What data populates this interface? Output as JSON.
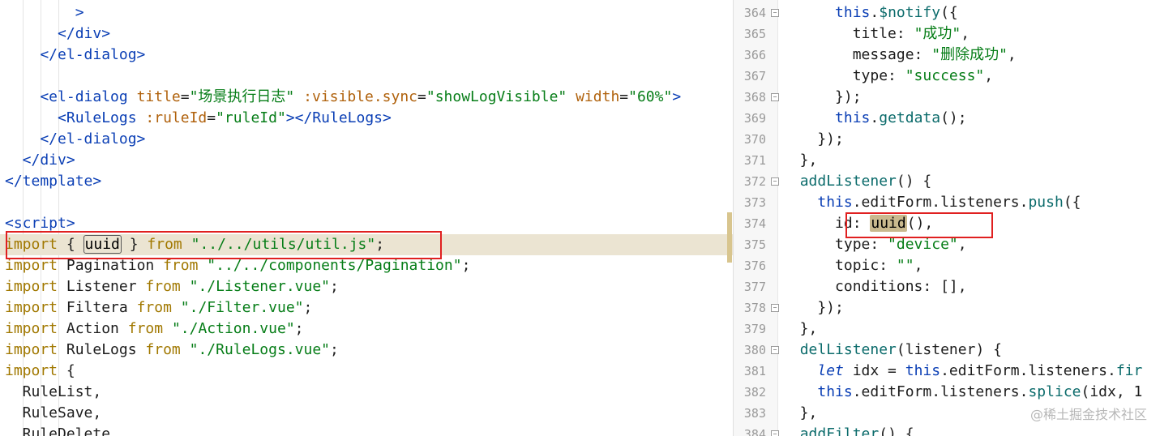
{
  "left_editor": {
    "lines": [
      [
        {
          "t": "        >",
          "c": "tag"
        }
      ],
      [
        {
          "t": "      </div>",
          "c": "tag"
        }
      ],
      [
        {
          "t": "    </el-dialog>",
          "c": "tag"
        }
      ],
      [
        {
          "t": "",
          "c": "plain"
        }
      ],
      [
        {
          "t": "    <el-dialog ",
          "c": "tag"
        },
        {
          "t": "title",
          "c": "attr"
        },
        {
          "t": "=",
          "c": "sym"
        },
        {
          "t": "\"场景执行日志\"",
          "c": "str"
        },
        {
          "t": " :",
          "c": "attr"
        },
        {
          "t": "visible.sync",
          "c": "attr"
        },
        {
          "t": "=",
          "c": "sym"
        },
        {
          "t": "\"showLogVisible\"",
          "c": "str"
        },
        {
          "t": " ",
          "c": "plain"
        },
        {
          "t": "width",
          "c": "attr"
        },
        {
          "t": "=",
          "c": "sym"
        },
        {
          "t": "\"60%\"",
          "c": "str"
        },
        {
          "t": ">",
          "c": "tag"
        }
      ],
      [
        {
          "t": "      <RuleLogs ",
          "c": "tag"
        },
        {
          "t": ":ruleId",
          "c": "attr"
        },
        {
          "t": "=",
          "c": "sym"
        },
        {
          "t": "\"ruleId\"",
          "c": "str"
        },
        {
          "t": "></RuleLogs>",
          "c": "tag"
        }
      ],
      [
        {
          "t": "    </el-dialog>",
          "c": "tag"
        }
      ],
      [
        {
          "t": "  </div>",
          "c": "tag"
        }
      ],
      [
        {
          "t": "</template>",
          "c": "tag"
        }
      ],
      [
        {
          "t": "",
          "c": "plain"
        }
      ],
      [
        {
          "t": "<script>",
          "c": "tag"
        }
      ],
      [
        {
          "t": "import",
          "c": "kw2"
        },
        {
          "t": " { ",
          "c": "plain"
        },
        {
          "t": "uuid",
          "c": "boxed"
        },
        {
          "t": " } ",
          "c": "plain"
        },
        {
          "t": "from",
          "c": "kw2"
        },
        {
          "t": " ",
          "c": "plain"
        },
        {
          "t": "\"../../utils/util.js\"",
          "c": "str"
        },
        {
          "t": ";",
          "c": "plain"
        }
      ],
      [
        {
          "t": "import",
          "c": "kw2"
        },
        {
          "t": " Pagination ",
          "c": "plain"
        },
        {
          "t": "from",
          "c": "kw2"
        },
        {
          "t": " ",
          "c": "plain"
        },
        {
          "t": "\"../../components/Pagination\"",
          "c": "str"
        },
        {
          "t": ";",
          "c": "plain"
        }
      ],
      [
        {
          "t": "import",
          "c": "kw2"
        },
        {
          "t": " Listener ",
          "c": "plain"
        },
        {
          "t": "from",
          "c": "kw2"
        },
        {
          "t": " ",
          "c": "plain"
        },
        {
          "t": "\"./Listener.vue\"",
          "c": "str"
        },
        {
          "t": ";",
          "c": "plain"
        }
      ],
      [
        {
          "t": "import",
          "c": "kw2"
        },
        {
          "t": " Filtera ",
          "c": "plain"
        },
        {
          "t": "from",
          "c": "kw2"
        },
        {
          "t": " ",
          "c": "plain"
        },
        {
          "t": "\"./Filter.vue\"",
          "c": "str"
        },
        {
          "t": ";",
          "c": "plain"
        }
      ],
      [
        {
          "t": "import",
          "c": "kw2"
        },
        {
          "t": " Action ",
          "c": "plain"
        },
        {
          "t": "from",
          "c": "kw2"
        },
        {
          "t": " ",
          "c": "plain"
        },
        {
          "t": "\"./Action.vue\"",
          "c": "str"
        },
        {
          "t": ";",
          "c": "plain"
        }
      ],
      [
        {
          "t": "import",
          "c": "kw2"
        },
        {
          "t": " RuleLogs ",
          "c": "plain"
        },
        {
          "t": "from",
          "c": "kw2"
        },
        {
          "t": " ",
          "c": "plain"
        },
        {
          "t": "\"./RuleLogs.vue\"",
          "c": "str"
        },
        {
          "t": ";",
          "c": "plain"
        }
      ],
      [
        {
          "t": "import",
          "c": "kw2"
        },
        {
          "t": " {",
          "c": "plain"
        }
      ],
      [
        {
          "t": "  RuleList,",
          "c": "plain"
        }
      ],
      [
        {
          "t": "  RuleSave,",
          "c": "plain"
        }
      ],
      [
        {
          "t": "  RuleDelete,",
          "c": "plain"
        }
      ]
    ]
  },
  "right_editor": {
    "lines": [
      {
        "n": "364",
        "fold": true,
        "seg": [
          {
            "t": "      ",
            "c": "plain"
          },
          {
            "t": "this",
            "c": "kw"
          },
          {
            "t": ".",
            "c": "plain"
          },
          {
            "t": "$notify",
            "c": "fn"
          },
          {
            "t": "({",
            "c": "plain"
          }
        ]
      },
      {
        "n": "365",
        "seg": [
          {
            "t": "        title: ",
            "c": "prop"
          },
          {
            "t": "\"成功\"",
            "c": "str"
          },
          {
            "t": ",",
            "c": "plain"
          }
        ]
      },
      {
        "n": "366",
        "seg": [
          {
            "t": "        message: ",
            "c": "prop"
          },
          {
            "t": "\"删除成功\"",
            "c": "str"
          },
          {
            "t": ",",
            "c": "plain"
          }
        ]
      },
      {
        "n": "367",
        "seg": [
          {
            "t": "        type: ",
            "c": "prop"
          },
          {
            "t": "\"success\"",
            "c": "str"
          },
          {
            "t": ",",
            "c": "plain"
          }
        ]
      },
      {
        "n": "368",
        "fold": true,
        "seg": [
          {
            "t": "      });",
            "c": "plain"
          }
        ]
      },
      {
        "n": "369",
        "seg": [
          {
            "t": "      ",
            "c": "plain"
          },
          {
            "t": "this",
            "c": "kw"
          },
          {
            "t": ".",
            "c": "plain"
          },
          {
            "t": "getdata",
            "c": "fn"
          },
          {
            "t": "();",
            "c": "plain"
          }
        ]
      },
      {
        "n": "370",
        "seg": [
          {
            "t": "    });",
            "c": "plain"
          }
        ]
      },
      {
        "n": "371",
        "seg": [
          {
            "t": "  },",
            "c": "plain"
          }
        ]
      },
      {
        "n": "372",
        "fold": true,
        "seg": [
          {
            "t": "  ",
            "c": "plain"
          },
          {
            "t": "addListener",
            "c": "fn"
          },
          {
            "t": "() {",
            "c": "plain"
          }
        ]
      },
      {
        "n": "373",
        "seg": [
          {
            "t": "    ",
            "c": "plain"
          },
          {
            "t": "this",
            "c": "kw"
          },
          {
            "t": ".editForm.listeners.",
            "c": "plain"
          },
          {
            "t": "push",
            "c": "fn"
          },
          {
            "t": "({",
            "c": "plain"
          }
        ]
      },
      {
        "n": "374",
        "seg": [
          {
            "t": "      id: ",
            "c": "prop"
          },
          {
            "t": "uuid",
            "c": "boxed2"
          },
          {
            "t": "(),",
            "c": "plain"
          }
        ]
      },
      {
        "n": "375",
        "seg": [
          {
            "t": "      type: ",
            "c": "prop"
          },
          {
            "t": "\"device\"",
            "c": "str"
          },
          {
            "t": ",",
            "c": "plain"
          }
        ]
      },
      {
        "n": "376",
        "seg": [
          {
            "t": "      topic: ",
            "c": "prop"
          },
          {
            "t": "\"\"",
            "c": "str"
          },
          {
            "t": ",",
            "c": "plain"
          }
        ]
      },
      {
        "n": "377",
        "seg": [
          {
            "t": "      conditions: [],",
            "c": "prop"
          }
        ]
      },
      {
        "n": "378",
        "fold": true,
        "seg": [
          {
            "t": "    });",
            "c": "plain"
          }
        ]
      },
      {
        "n": "379",
        "seg": [
          {
            "t": "  },",
            "c": "plain"
          }
        ]
      },
      {
        "n": "380",
        "fold": true,
        "seg": [
          {
            "t": "  ",
            "c": "plain"
          },
          {
            "t": "delListener",
            "c": "fn"
          },
          {
            "t": "(listener) {",
            "c": "plain"
          }
        ]
      },
      {
        "n": "381",
        "seg": [
          {
            "t": "    ",
            "c": "plain"
          },
          {
            "t": "let",
            "c": "kwi"
          },
          {
            "t": " idx = ",
            "c": "plain"
          },
          {
            "t": "this",
            "c": "kw"
          },
          {
            "t": ".editForm.listeners.",
            "c": "plain"
          },
          {
            "t": "fir",
            "c": "fn"
          }
        ]
      },
      {
        "n": "382",
        "seg": [
          {
            "t": "    ",
            "c": "plain"
          },
          {
            "t": "this",
            "c": "kw"
          },
          {
            "t": ".editForm.listeners.",
            "c": "plain"
          },
          {
            "t": "splice",
            "c": "fn"
          },
          {
            "t": "(idx, 1",
            "c": "plain"
          }
        ]
      },
      {
        "n": "383",
        "seg": [
          {
            "t": "  },",
            "c": "plain"
          }
        ]
      },
      {
        "n": "384",
        "fold": true,
        "seg": [
          {
            "t": "  ",
            "c": "plain"
          },
          {
            "t": "addFilter",
            "c": "fn"
          },
          {
            "t": "() {",
            "c": "plain"
          }
        ]
      }
    ]
  },
  "watermark": "@稀土掘金技术社区"
}
